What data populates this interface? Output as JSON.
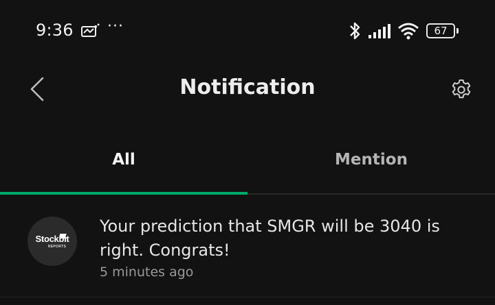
{
  "status_bar": {
    "time": "9:36",
    "more": "···",
    "battery_level": "67",
    "icons": [
      "notification-app-icon",
      "bluetooth-icon",
      "signal-icon",
      "wifi-icon",
      "battery-icon"
    ]
  },
  "header": {
    "title": "Notification",
    "back_icon": "chevron-left-icon",
    "settings_icon": "gear-icon"
  },
  "tabs": [
    {
      "label": "All",
      "active": true
    },
    {
      "label": "Mention",
      "active": false
    }
  ],
  "colors": {
    "background": "#121212",
    "accent": "#00ab6b",
    "primary_text": "#e6e6e6",
    "secondary_text": "#9a9a9a"
  },
  "notifications": [
    {
      "avatar_brand": "Stockbit",
      "avatar_sub": "REPORTS",
      "message": "Your prediction that SMGR will be 3040 is right. Congrats!",
      "time": "5 minutes ago"
    }
  ]
}
